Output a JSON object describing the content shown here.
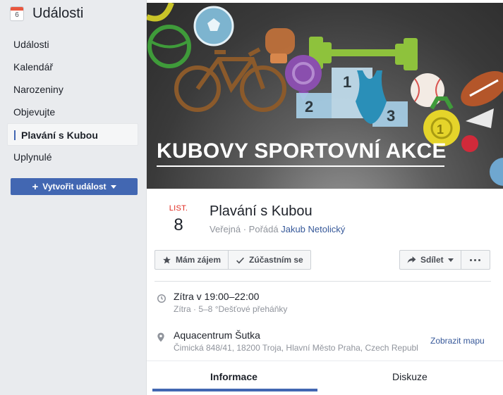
{
  "app": {
    "title": "Události",
    "calendar_icon_day": "6"
  },
  "sidebar": {
    "items": [
      {
        "label": "Události",
        "active": false
      },
      {
        "label": "Kalendář",
        "active": false
      },
      {
        "label": "Narozeniny",
        "active": false
      },
      {
        "label": "Objevujte",
        "active": false
      },
      {
        "label": "Plavání s Kubou",
        "active": true
      },
      {
        "label": "Uplynulé",
        "active": false
      }
    ],
    "create_button_label": "Vytvořit událost"
  },
  "cover": {
    "title": "KUBOVY SPORTOVNÍ AKCE"
  },
  "event": {
    "month": "LIST.",
    "day": "8",
    "title": "Plavání s Kubou",
    "visibility": "Veřejná",
    "organizer_label": "Pořádá",
    "host": "Jakub Netolický"
  },
  "actions": {
    "interested_label": "Mám zájem",
    "going_label": "Zúčastním se",
    "share_label": "Sdílet"
  },
  "details": {
    "time_main": "Zítra v 19:00–22:00",
    "time_sub": "Zítra · 5–8 °Dešťové přeháňky",
    "place_main": "Aquacentrum Šutka",
    "place_sub": "Čimická 848/41, 18200 Troja, Hlavní Město Praha, Czech Republ",
    "map_link": "Zobrazit mapu"
  },
  "tabs": {
    "info": "Informace",
    "discussion": "Diskuze"
  },
  "colors": {
    "accent": "#4267b2",
    "link": "#365899",
    "month_red": "#e02a20",
    "background": "#e9ebee"
  }
}
